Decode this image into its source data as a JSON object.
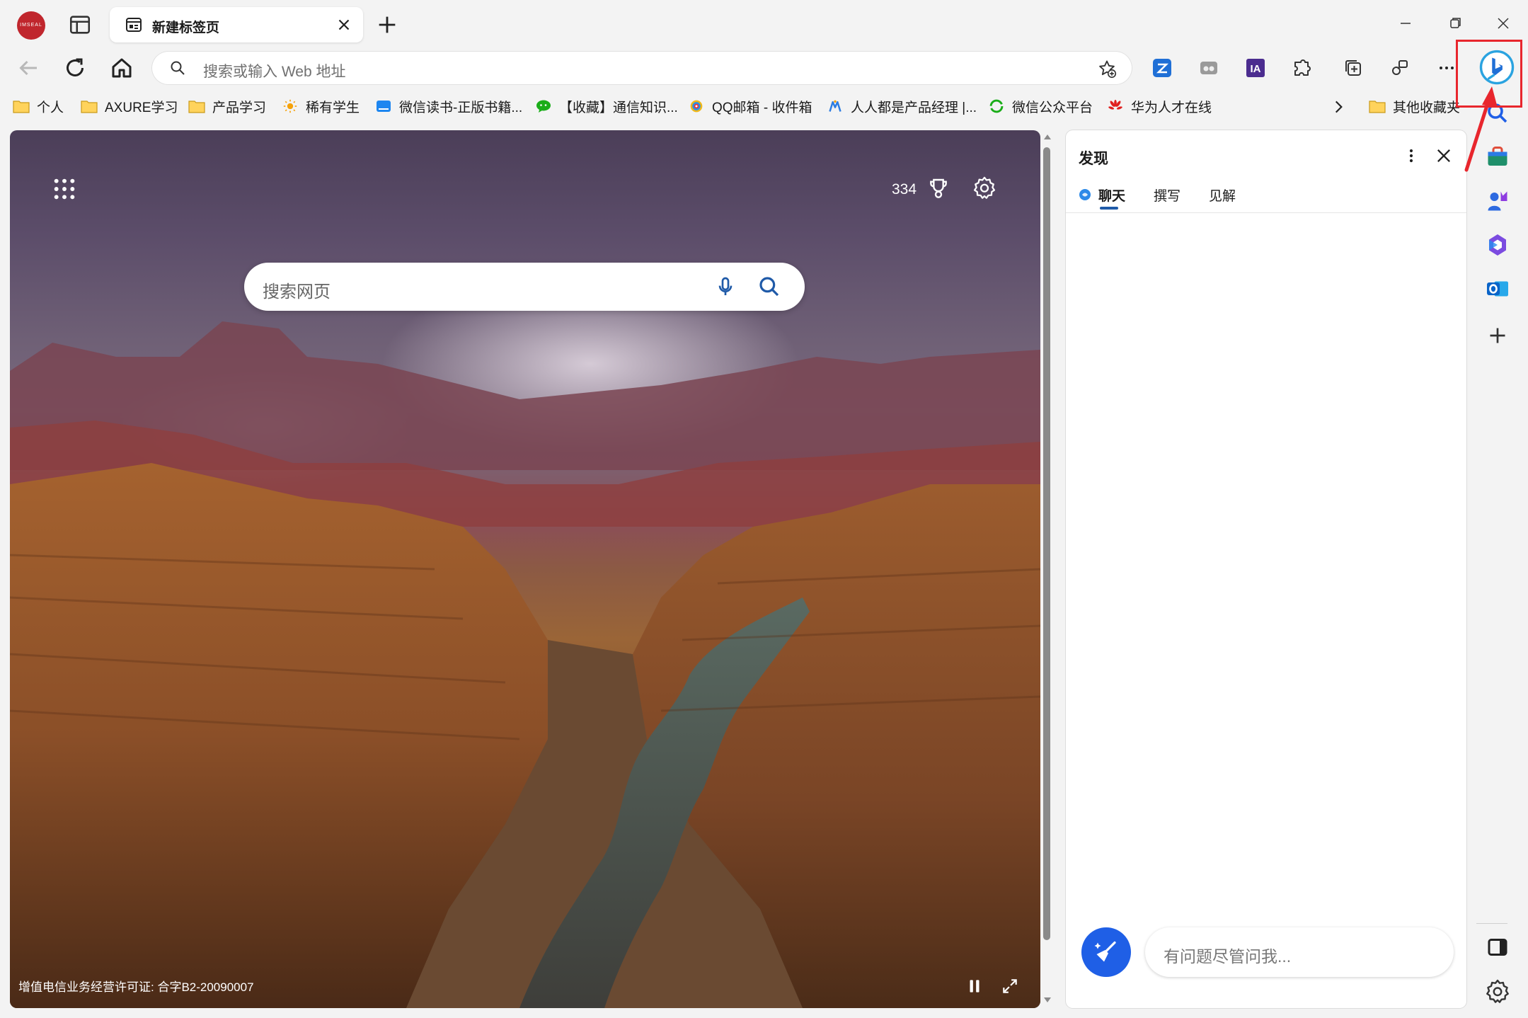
{
  "profile": {
    "label": "IMSEAL"
  },
  "tab": {
    "title": "新建标签页"
  },
  "address": {
    "placeholder": "搜索或输入 Web 地址"
  },
  "favorites": [
    {
      "label": "个人",
      "icon": "folder-icon"
    },
    {
      "label": "AXURE学习",
      "icon": "folder-icon"
    },
    {
      "label": "产品学习",
      "icon": "folder-icon"
    },
    {
      "label": "稀有学生",
      "icon": "sun-icon"
    },
    {
      "label": "微信读书-正版书籍...",
      "icon": "book-icon"
    },
    {
      "label": "【收藏】通信知识...",
      "icon": "wechat-icon"
    },
    {
      "label": "QQ邮箱 - 收件箱",
      "icon": "qq-mail-icon"
    },
    {
      "label": "人人都是产品经理 |...",
      "icon": "pm-logo-icon"
    },
    {
      "label": "微信公众平台",
      "icon": "wechat-mp-icon"
    },
    {
      "label": "华为人才在线",
      "icon": "huawei-icon"
    },
    {
      "label": "其他收藏夹",
      "icon": "folder-icon"
    }
  ],
  "newtab": {
    "points": "334",
    "search_placeholder": "搜索网页",
    "license": "增值电信业务经营许可证: 合字B2-20090007"
  },
  "panel": {
    "title": "发现",
    "tabs": [
      "聊天",
      "撰写",
      "见解"
    ],
    "input_placeholder": "有问题尽管问我..."
  },
  "colors": {
    "accent": "#1f5fe6",
    "highlight": "#e8262d",
    "tab_underline": "#1f5aa8"
  }
}
